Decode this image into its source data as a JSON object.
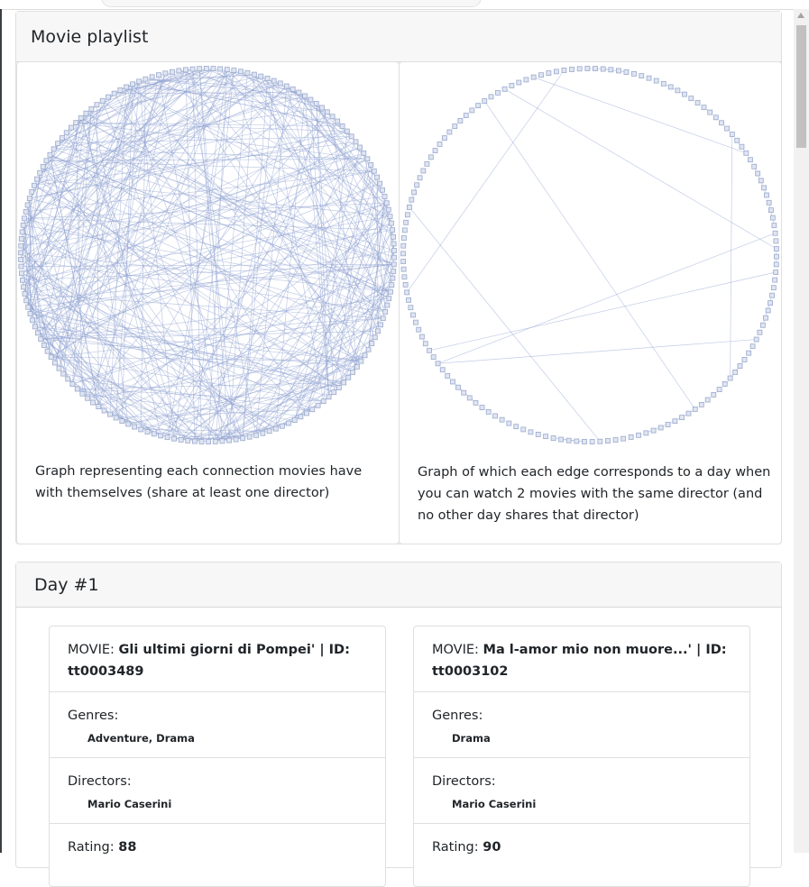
{
  "playlist": {
    "title": "Movie playlist",
    "graph1_caption": "Graph representing each connection movies have with themselves (share at least one director)",
    "graph2_caption": "Graph of which each edge corresponds to a day when you can watch 2 movies with the same director (and no other day shares that director)"
  },
  "day": {
    "title": "Day #1",
    "movies": [
      {
        "prefix": "MOVIE:",
        "heading": "Gli ultimi giorni di Pompei' | ID: tt0003489",
        "genres_label": "Genres:",
        "genres": "Adventure, Drama",
        "directors_label": "Directors:",
        "directors": "Mario Caserini",
        "rating_label": "Rating:",
        "rating": "88"
      },
      {
        "prefix": "MOVIE:",
        "heading": "Ma l-amor mio non muore...' | ID: tt0003102",
        "genres_label": "Genres:",
        "genres": "Drama",
        "directors_label": "Directors:",
        "directors": "Mario Caserini",
        "rating_label": "Rating:",
        "rating": "90"
      }
    ]
  },
  "colors": {
    "graph_node": "#9aa9cc",
    "graph_edge": "#8fa3d1"
  }
}
